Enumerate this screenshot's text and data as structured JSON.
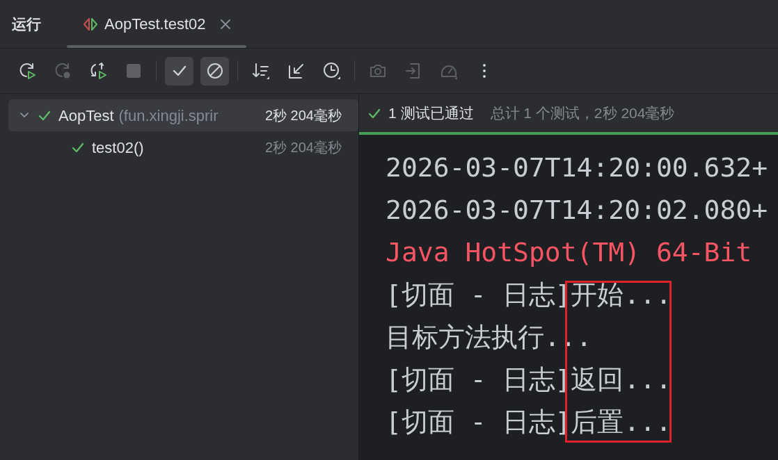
{
  "tool_window": {
    "title": "运行",
    "tabs": [
      {
        "label": "AopTest.test02",
        "selected": true,
        "closable": true
      }
    ]
  },
  "toolbar": {
    "groups": [
      [
        {
          "kind": "rerun",
          "disabled": false,
          "selected": false
        },
        {
          "kind": "rerun-failed",
          "disabled": true,
          "selected": false
        },
        {
          "kind": "toggle-auto",
          "disabled": false,
          "selected": false
        },
        {
          "kind": "stop",
          "disabled": true,
          "selected": false
        }
      ],
      [
        {
          "kind": "show-passed",
          "disabled": false,
          "selected": true
        },
        {
          "kind": "show-ignored",
          "disabled": false,
          "selected": true
        }
      ],
      [
        {
          "kind": "sort",
          "disabled": false,
          "selected": false
        },
        {
          "kind": "collapse",
          "disabled": false,
          "selected": false
        },
        {
          "kind": "history",
          "disabled": false,
          "selected": false
        }
      ],
      [
        {
          "kind": "camera",
          "disabled": true,
          "selected": false
        },
        {
          "kind": "import",
          "disabled": true,
          "selected": false
        },
        {
          "kind": "gauge",
          "disabled": true,
          "selected": false
        },
        {
          "kind": "more",
          "disabled": false,
          "selected": false
        }
      ]
    ]
  },
  "tree": [
    {
      "label": "AopTest",
      "detail": "(fun.xingji.sprir",
      "time": "2秒 204毫秒",
      "passed": true,
      "expanded": true,
      "selected": true,
      "children": [
        {
          "label": "test02()",
          "time": "2秒 204毫秒",
          "passed": true,
          "selected": false
        }
      ]
    }
  ],
  "status": {
    "summary": "1 测试已通过",
    "detail": "总计 1 个测试，2秒 204毫秒",
    "passed": true
  },
  "console": [
    {
      "kind": "log",
      "text": "2026-03-07T14:20:00.632+"
    },
    {
      "kind": "log",
      "text": "2026-03-07T14:20:02.080+"
    },
    {
      "kind": "error",
      "text": "Java HotSpot(TM) 64-Bit"
    },
    {
      "kind": "log",
      "text": "[切面 - 日志]开始..."
    },
    {
      "kind": "log",
      "text": "目标方法执行..."
    },
    {
      "kind": "log",
      "text": "[切面 - 日志]返回..."
    },
    {
      "kind": "log",
      "text": "[切面 - 日志]后置..."
    }
  ]
}
